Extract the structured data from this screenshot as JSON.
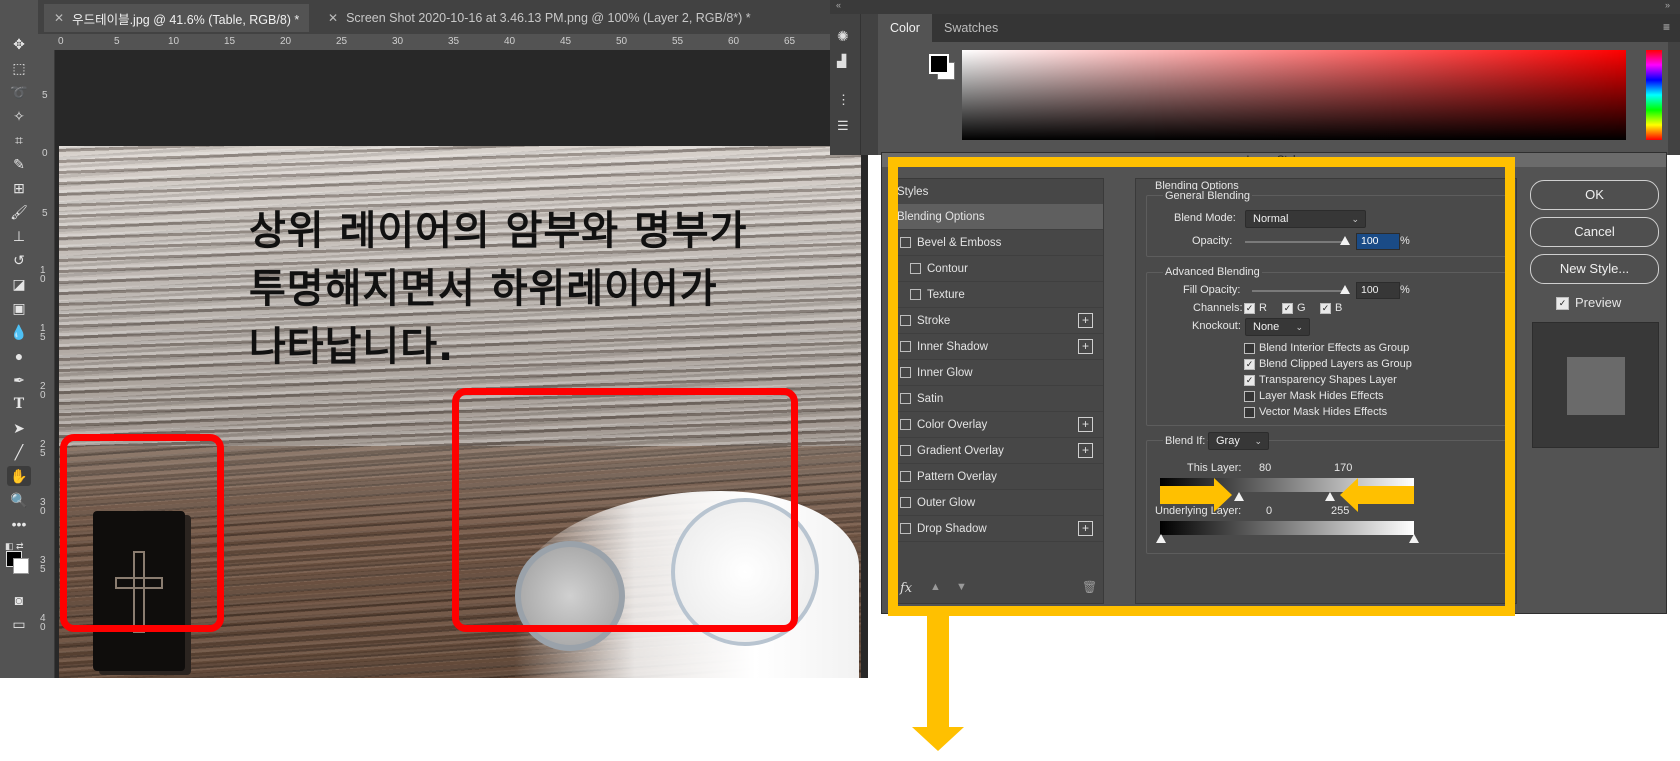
{
  "tabs": [
    {
      "label": "우드테이블.jpg @ 41.6% (Table, RGB/8) *",
      "active": true
    },
    {
      "label": "Screen Shot 2020-10-16 at 3.46.13 PM.png @ 100% (Layer 2, RGB/8*) *",
      "active": false
    }
  ],
  "ruler": {
    "top": [
      "0",
      "5",
      "10",
      "15",
      "20",
      "25",
      "30",
      "35",
      "40",
      "45",
      "50",
      "55",
      "60",
      "65"
    ],
    "left": [
      "5",
      "0",
      "5",
      "1 0",
      "1 5",
      "2 0",
      "2 5",
      "3 0",
      "3 5",
      "4 0"
    ]
  },
  "canvas": {
    "overlay_text": [
      "상위 레이어의 암부와 명부가",
      "투명해지면서 하위레이어가",
      "나타납니다."
    ]
  },
  "color_panel": {
    "tabs": [
      "Color",
      "Swatches"
    ],
    "foreground": "#000000",
    "background": "#ffffff"
  },
  "dialog": {
    "title": "Layer Style",
    "styles_header": "Styles",
    "styles": [
      {
        "label": "Blending Options",
        "checkbox": false,
        "plus": false,
        "selected": true,
        "indent": false
      },
      {
        "label": "Bevel & Emboss",
        "checkbox": true,
        "plus": false,
        "indent": false
      },
      {
        "label": "Contour",
        "checkbox": true,
        "plus": false,
        "indent": true
      },
      {
        "label": "Texture",
        "checkbox": true,
        "plus": false,
        "indent": true
      },
      {
        "label": "Stroke",
        "checkbox": true,
        "plus": true,
        "indent": false
      },
      {
        "label": "Inner Shadow",
        "checkbox": true,
        "plus": true,
        "indent": false
      },
      {
        "label": "Inner Glow",
        "checkbox": true,
        "plus": false,
        "indent": false
      },
      {
        "label": "Satin",
        "checkbox": true,
        "plus": false,
        "indent": false
      },
      {
        "label": "Color Overlay",
        "checkbox": true,
        "plus": true,
        "indent": false
      },
      {
        "label": "Gradient Overlay",
        "checkbox": true,
        "plus": true,
        "indent": false
      },
      {
        "label": "Pattern Overlay",
        "checkbox": true,
        "plus": false,
        "indent": false
      },
      {
        "label": "Outer Glow",
        "checkbox": true,
        "plus": false,
        "indent": false
      },
      {
        "label": "Drop Shadow",
        "checkbox": true,
        "plus": true,
        "indent": false
      }
    ],
    "blending_options": {
      "title": "Blending Options",
      "general_title": "General Blending",
      "blend_mode_label": "Blend Mode:",
      "blend_mode": "Normal",
      "opacity_label": "Opacity:",
      "opacity": "100",
      "opacity_unit": "%",
      "advanced_title": "Advanced Blending",
      "fill_opacity_label": "Fill Opacity:",
      "fill_opacity": "100",
      "fill_unit": "%",
      "channels_label": "Channels:",
      "channels": [
        "R",
        "G",
        "B"
      ],
      "knockout_label": "Knockout:",
      "knockout": "None",
      "checkboxes": [
        {
          "label": "Blend Interior Effects as Group",
          "checked": false
        },
        {
          "label": "Blend Clipped Layers as Group",
          "checked": true
        },
        {
          "label": "Transparency Shapes Layer",
          "checked": true
        },
        {
          "label": "Layer Mask Hides Effects",
          "checked": false
        },
        {
          "label": "Vector Mask Hides Effects",
          "checked": false
        }
      ],
      "blend_if_label": "Blend If:",
      "blend_if": "Gray",
      "this_layer_label": "This Layer:",
      "this_layer_low": "80",
      "this_layer_high": "170",
      "underlying_label": "Underlying Layer:",
      "underlying_low": "0",
      "underlying_high": "255"
    },
    "buttons": {
      "ok": "OK",
      "cancel": "Cancel",
      "new_style": "New Style...",
      "preview": "Preview"
    }
  }
}
